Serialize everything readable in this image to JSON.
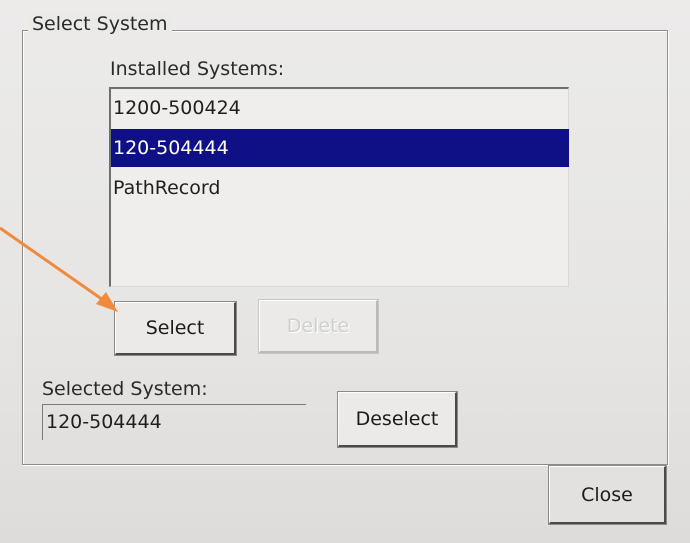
{
  "dialog": {
    "group_title": "Select System",
    "installed_label": "Installed Systems:",
    "installed_systems": [
      {
        "label": "1200-500424",
        "selected": false
      },
      {
        "label": "120-504444",
        "selected": true
      },
      {
        "label": "PathRecord",
        "selected": false
      }
    ],
    "select_button": "Select",
    "delete_button": "Delete",
    "selected_label": "Selected System:",
    "selected_value": "120-504444",
    "deselect_button": "Deselect",
    "close_button": "Close"
  },
  "colors": {
    "selection": "#0f0f86",
    "annotation_arrow": "#f08a3c"
  },
  "annotation": {
    "icon": "arrow-pointer-icon"
  }
}
